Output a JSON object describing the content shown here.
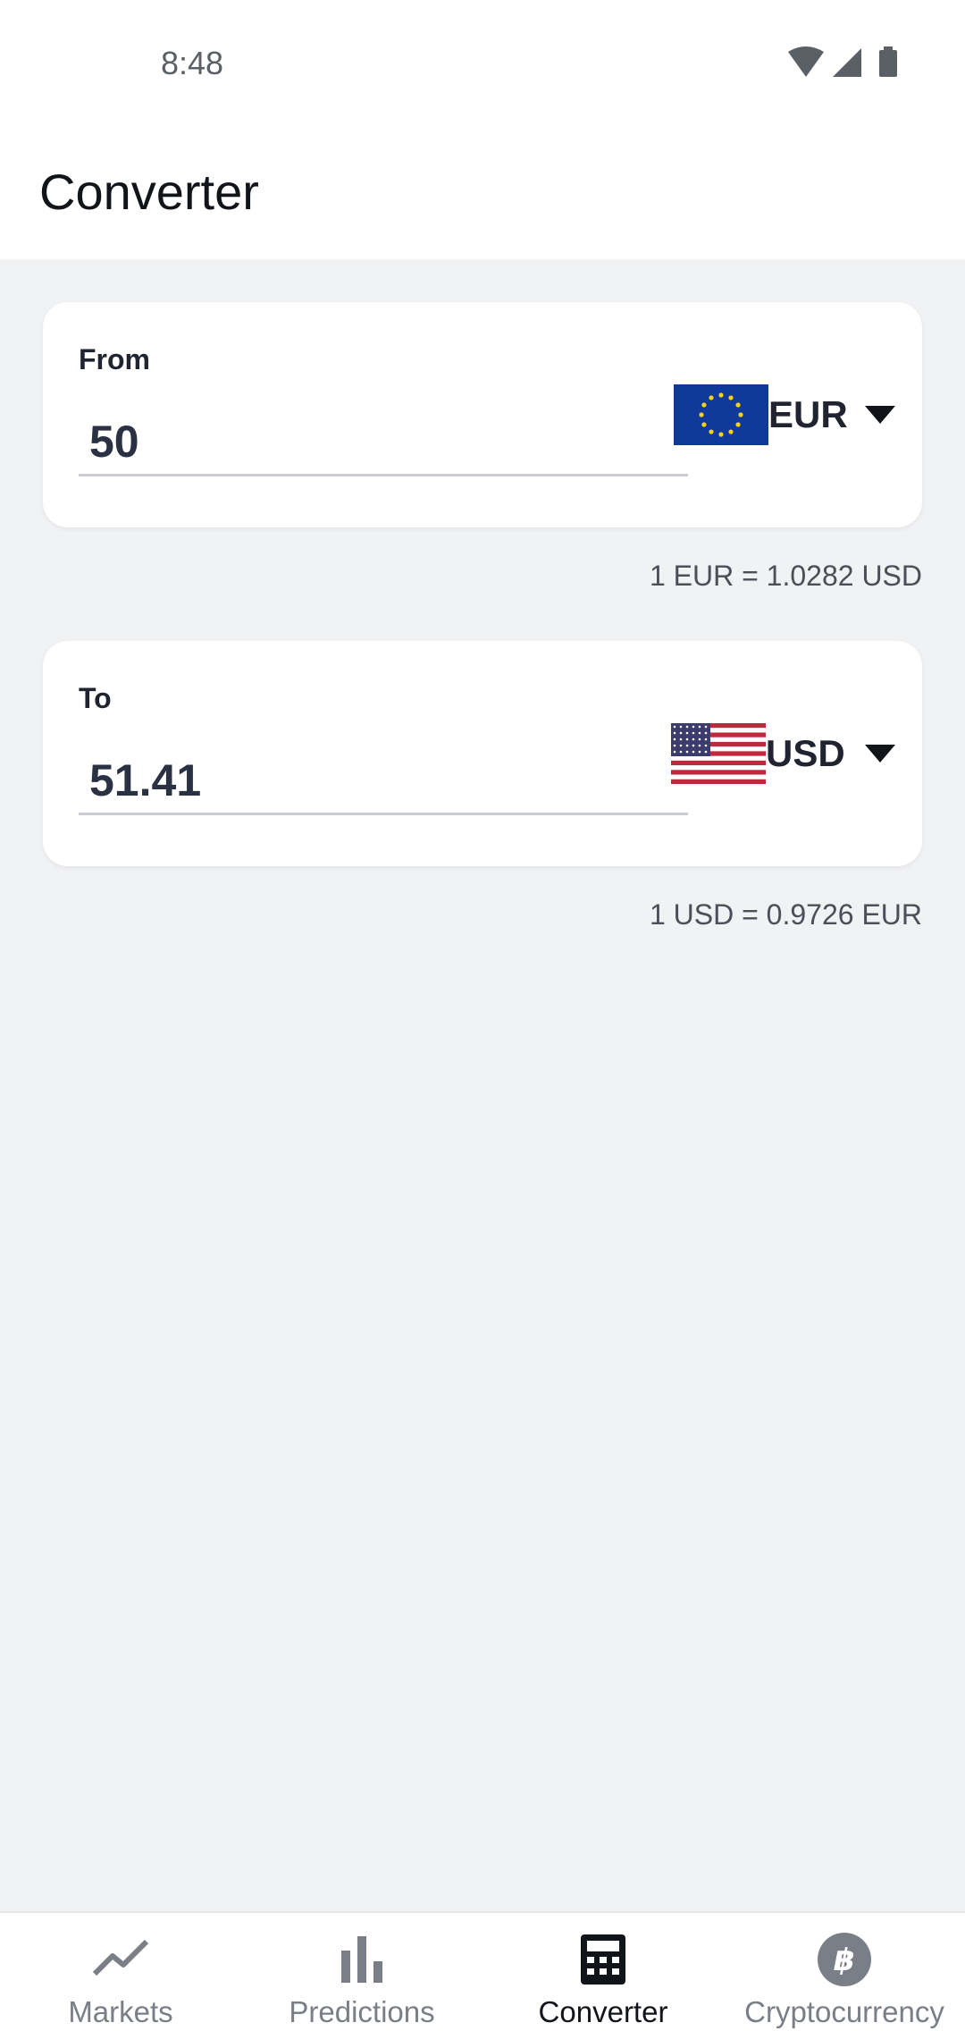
{
  "status_bar": {
    "time": "8:48",
    "icons": [
      "wifi-icon",
      "signal-icon",
      "battery-icon"
    ]
  },
  "app_bar": {
    "title": "Converter"
  },
  "from": {
    "label": "From",
    "amount": "50",
    "currency": "EUR",
    "flag": "eu-flag-icon",
    "rate": "1 EUR = 1.0282 USD"
  },
  "to": {
    "label": "To",
    "amount": "51.41",
    "currency": "USD",
    "flag": "us-flag-icon",
    "rate": "1 USD = 0.9726 EUR"
  },
  "bottom_nav": {
    "items": [
      {
        "label": "Markets",
        "icon": "trending-up-icon",
        "active": false
      },
      {
        "label": "Predictions",
        "icon": "bar-chart-icon",
        "active": false
      },
      {
        "label": "Converter",
        "icon": "calculator-icon",
        "active": true
      },
      {
        "label": "Cryptocurrency",
        "icon": "bitcoin-icon",
        "active": false
      }
    ]
  },
  "colors": {
    "background": "#f1f2f4",
    "card": "#ffffff",
    "text": "#1f2430",
    "inactive_nav": "#7a7e86",
    "active_nav": "#111418"
  }
}
